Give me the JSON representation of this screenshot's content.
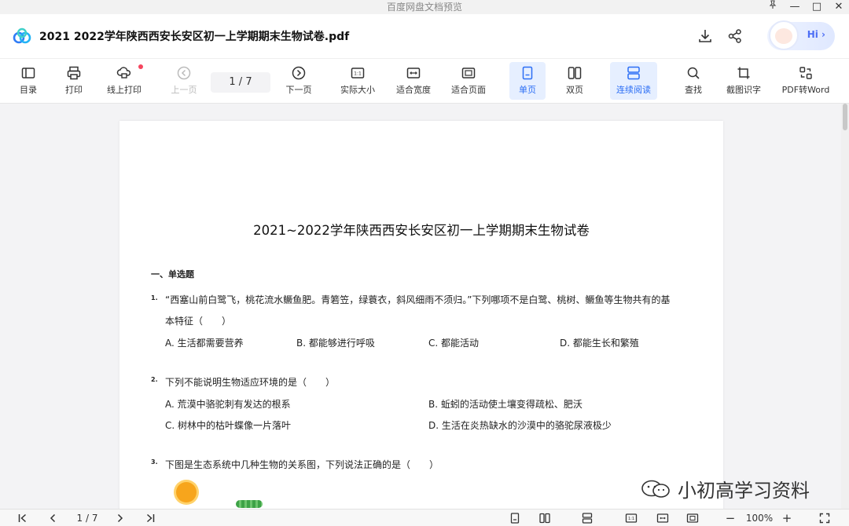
{
  "window": {
    "title": "百度网盘文档预览",
    "pin": "📌",
    "minimize": "—",
    "maximize": "□",
    "close": "✕"
  },
  "header": {
    "doc_title": "2021  2022学年陕西西安长安区初一上学期期末生物试卷.pdf",
    "hi": "Hi ›"
  },
  "toolbar": {
    "toc": "目录",
    "print": "打印",
    "online_print": "线上打印",
    "prev": "上一页",
    "page": "1 / 7",
    "next": "下一页",
    "actual_size": "实际大小",
    "fit_width": "适合宽度",
    "fit_page": "适合页面",
    "single": "单页",
    "double": "双页",
    "continuous": "连续阅读",
    "find": "查找",
    "ocr": "截图识字",
    "pdf_word": "PDF转Word"
  },
  "document": {
    "title": "2021~2022学年陕西西安长安区初一上学期期末生物试卷",
    "section": "一、单选题",
    "questions": [
      {
        "num": "1.",
        "line1": "“西塞山前白鹭飞，桃花流水鳜鱼肥。青箬笠，绿蓑衣，斜风细雨不须归。”下列哪项不是白鹭、桃树、鳜鱼等生物共有的基",
        "line2": "本特征（　　）",
        "options": [
          "A. 生活都需要营养",
          "B. 都能够进行呼吸",
          "C. 都能活动",
          "D. 都能生长和繁殖"
        ]
      },
      {
        "num": "2.",
        "line1": "下列不能说明生物适应环境的是（　　）",
        "options": [
          "A. 荒漠中骆驼刺有发达的根系",
          "B. 蚯蚓的活动使土壤变得疏松、肥沃",
          "C. 树林中的枯叶蝶像一片落叶",
          "D. 生活在炎热缺水的沙漠中的骆驼尿液极少"
        ]
      },
      {
        "num": "3.",
        "line1": "下图是生态系统中几种生物的关系图，下列说法正确的是（　　）"
      }
    ]
  },
  "watermark": "小初高学习资料",
  "bottom": {
    "first": "|‹",
    "prev": "‹",
    "page": "1 / 7",
    "next": "›",
    "last": "›|",
    "zoom_out": "−",
    "zoom": "100%",
    "zoom_in": "+"
  }
}
